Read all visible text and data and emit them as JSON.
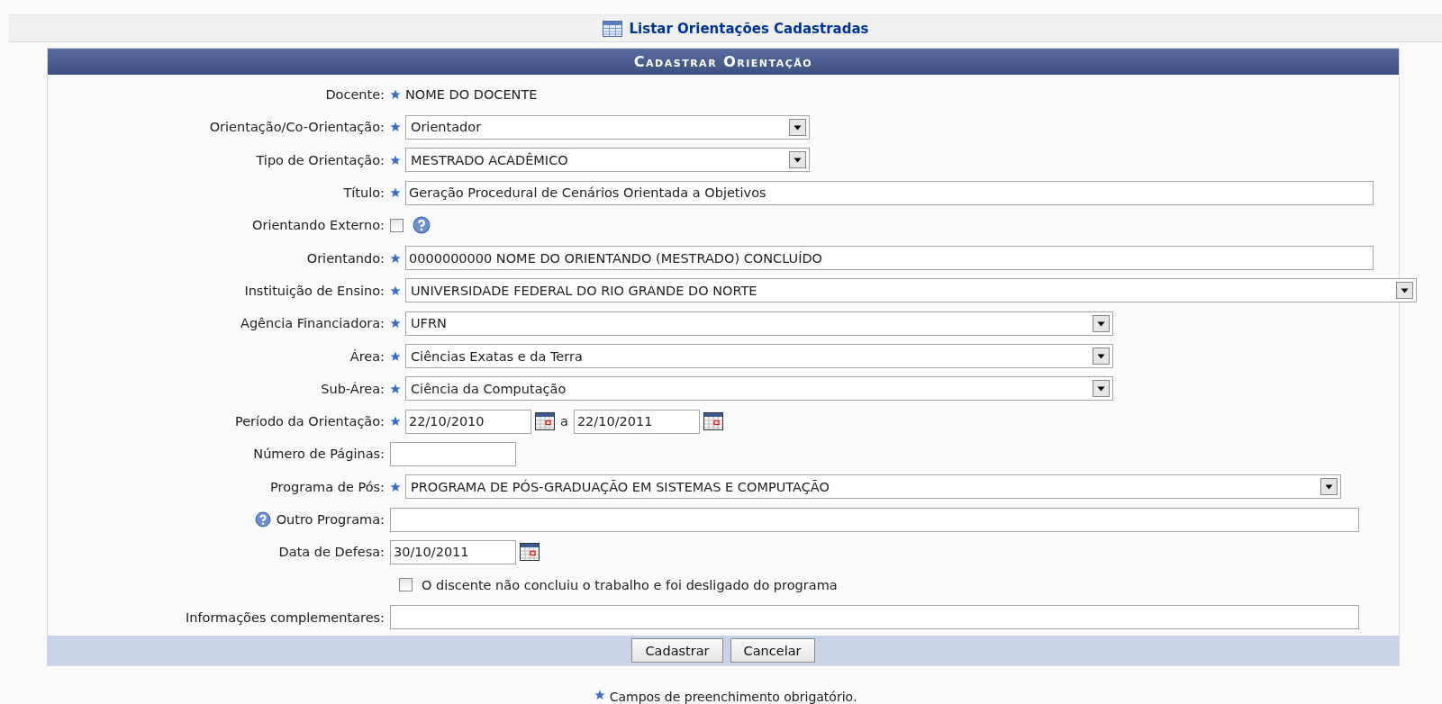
{
  "top_link": {
    "label": "Listar Orientações Cadastradas"
  },
  "form": {
    "title": "Cadastrar Orientação",
    "rows": [
      {
        "label": "Docente:",
        "required": true,
        "kind": "static",
        "value": "NOME DO DOCENTE"
      },
      {
        "label": "Orientação/Co-Orientação:",
        "required": true,
        "kind": "select",
        "value": "Orientador"
      },
      {
        "label": "Tipo de Orientação:",
        "required": true,
        "kind": "select",
        "value": "MESTRADO ACADÊMICO"
      },
      {
        "label": "Título:",
        "required": true,
        "kind": "text",
        "value": "Geração Procedural de Cenários Orientada a Objetivos"
      },
      {
        "label": "Orientando Externo:",
        "required": false,
        "kind": "checkbox",
        "checked": false,
        "help": true
      },
      {
        "label": "Orientando:",
        "required": true,
        "kind": "text",
        "value": "0000000000 NOME DO ORIENTANDO (MESTRADO) CONCLUÍDO"
      },
      {
        "label": "Instituição de Ensino:",
        "required": true,
        "kind": "select",
        "value": "UNIVERSIDADE FEDERAL DO RIO GRANDE DO NORTE"
      },
      {
        "label": "Agência Financiadora:",
        "required": true,
        "kind": "select",
        "value": "UFRN"
      },
      {
        "label": "Área:",
        "required": true,
        "kind": "select",
        "value": "Ciências Exatas e da Terra"
      },
      {
        "label": "Sub-Área:",
        "required": true,
        "kind": "select",
        "value": "Ciência da Computação"
      },
      {
        "label": "Período da Orientação:",
        "required": true,
        "kind": "daterange",
        "value": "22/10/2010",
        "separator": "a",
        "value_end": "22/10/2011"
      },
      {
        "label": "Número de Páginas:",
        "required": false,
        "kind": "text"
      },
      {
        "label": "Programa de Pós:",
        "required": true,
        "kind": "select",
        "value": "PROGRAMA DE PÓS-GRADUAÇÃO EM SISTEMAS E COMPUTAÇÃO"
      },
      {
        "label": "Outro Programa:",
        "required": false,
        "kind": "text",
        "help": true
      },
      {
        "label": "Data de Defesa:",
        "required": false,
        "kind": "date",
        "value": "30/10/2011"
      },
      {
        "kind": "option",
        "checked": false,
        "text": "O discente não concluiu o trabalho e foi desligado do programa"
      },
      {
        "label": "Informações complementares:",
        "required": false,
        "kind": "text"
      }
    ],
    "buttons": [
      "Cadastrar",
      "Cancelar"
    ]
  },
  "footnote": "Campos de preenchimento obrigatório."
}
